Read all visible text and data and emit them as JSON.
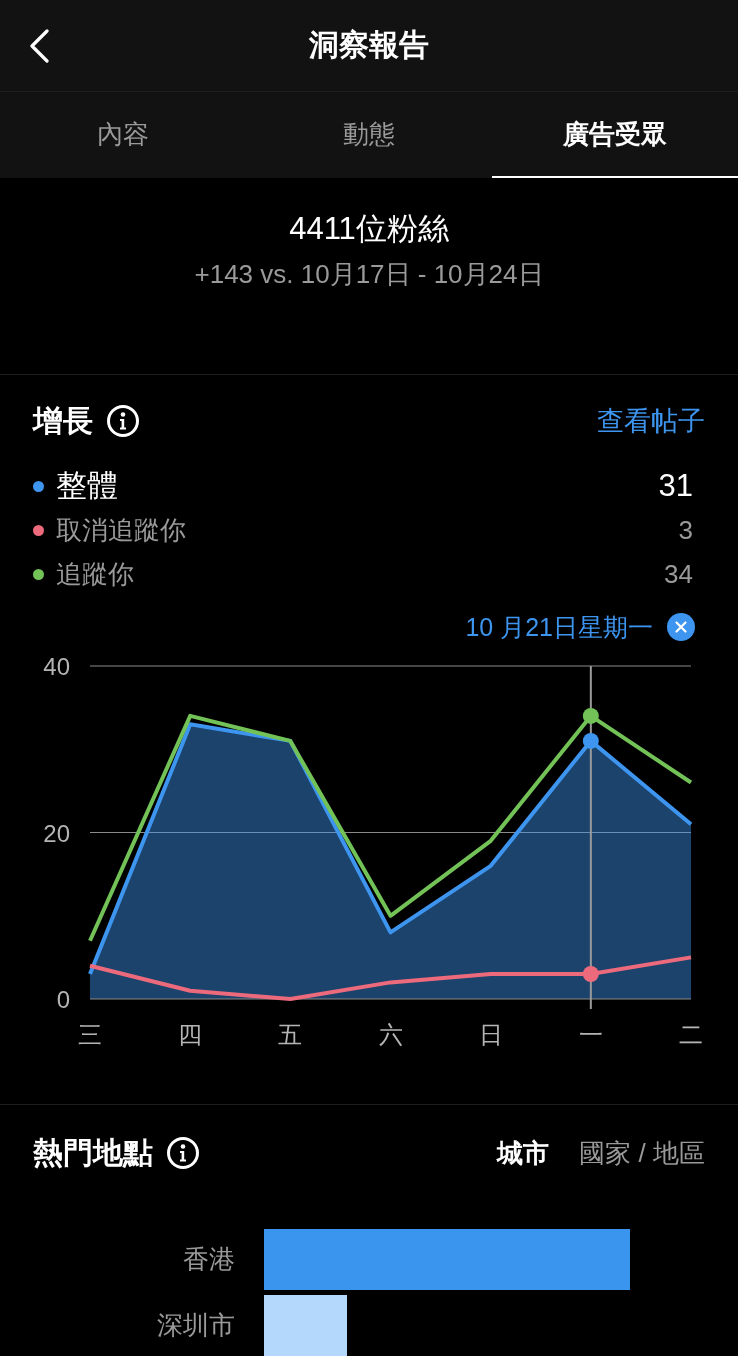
{
  "header": {
    "title": "洞察報告"
  },
  "tabs": [
    {
      "label": "內容",
      "selected": false
    },
    {
      "label": "動態",
      "selected": false
    },
    {
      "label": "廣告受眾",
      "selected": true
    }
  ],
  "summary": {
    "followers": "4411位粉絲",
    "change": "+143 vs. 10月17日 - 10月24日"
  },
  "growth": {
    "title": "增長",
    "link": "查看帖子",
    "legend": [
      {
        "kind": "total",
        "value": "31"
      },
      {
        "kind": "part",
        "value": "3"
      },
      {
        "kind": "part",
        "value": "34"
      }
    ],
    "selected_date": "10 月21日星期一",
    "chart_data": {
      "type": "line",
      "categories": [
        "三",
        "四",
        "五",
        "六",
        "日",
        "一",
        "二"
      ],
      "series": [
        {
          "name": "整體",
          "type": "area",
          "color": "#3d95ef",
          "values": [
            3,
            33,
            31,
            8,
            16,
            31,
            21
          ]
        },
        {
          "name": "取消追蹤你",
          "type": "line",
          "color": "#ec6a7c",
          "values": [
            4,
            1,
            0,
            2,
            3,
            3,
            5
          ]
        },
        {
          "name": "追蹤你",
          "type": "line",
          "color": "#72c257",
          "values": [
            7,
            34,
            31,
            10,
            19,
            34,
            26
          ]
        }
      ],
      "ylim": [
        0,
        40
      ],
      "yticks": [
        0,
        20,
        40
      ],
      "ref_lines": [
        {
          "axis": "y",
          "value": 20
        },
        {
          "axis": "y",
          "value": 40
        },
        {
          "axis": "x",
          "value": "一"
        }
      ]
    }
  },
  "top_locations": {
    "title": "熱門地點",
    "filters": [
      {
        "label": "城市",
        "selected": true
      },
      {
        "label": "國家 / 地區",
        "selected": false
      }
    ],
    "rows": [
      {
        "label": "香港",
        "color": "#3a95ef"
      },
      {
        "label": "深圳市",
        "color": "#b3d8fb"
      }
    ]
  }
}
